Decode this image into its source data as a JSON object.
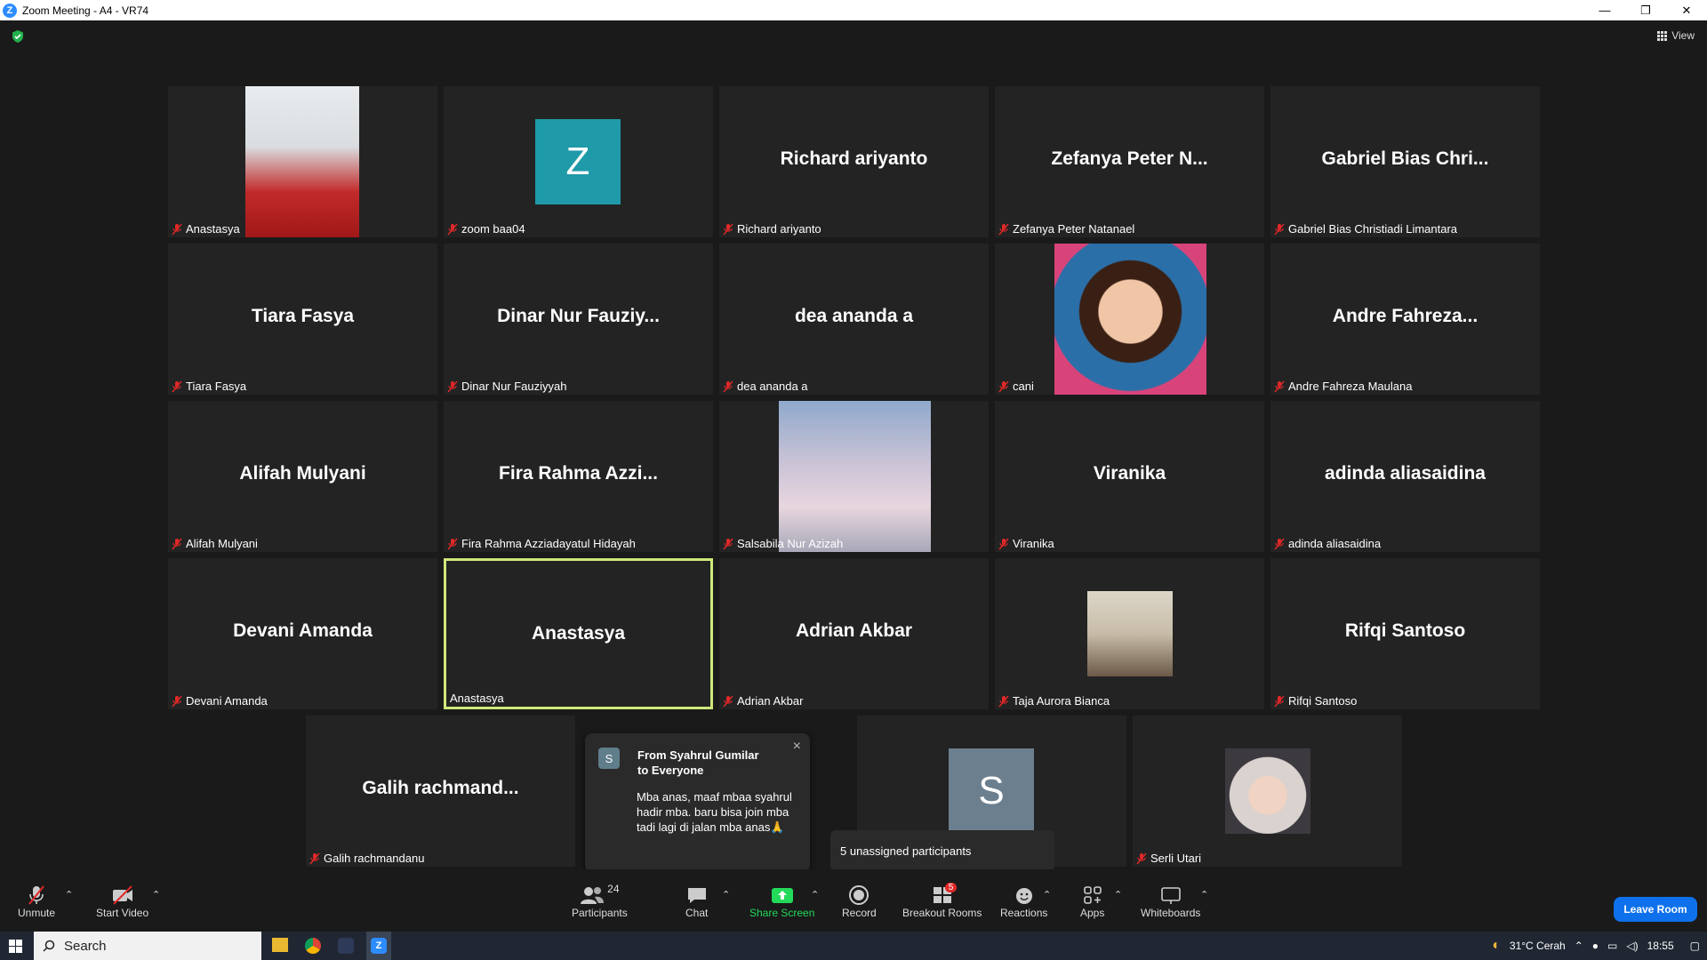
{
  "window": {
    "title": "Zoom Meeting - A4 - VR74",
    "minimize": "—",
    "restore": "❐",
    "close": "✕"
  },
  "view_label": "View",
  "tiles": [
    {
      "big": "",
      "label": "Anastasya",
      "photo": "woman",
      "mic": true
    },
    {
      "big": "",
      "label": "zoom baa04",
      "avatar": "Z",
      "avatar_color": "#1f9aa8",
      "mic": true
    },
    {
      "big": "Richard ariyanto",
      "label": "Richard ariyanto",
      "mic": true
    },
    {
      "big": "Zefanya Peter N...",
      "label": "Zefanya Peter Natanael",
      "mic": true
    },
    {
      "big": "Gabriel Bias Chri...",
      "label": "Gabriel Bias Christiadi Limantara",
      "mic": true
    },
    {
      "big": "Tiara Fasya",
      "label": "Tiara Fasya",
      "mic": true
    },
    {
      "big": "Dinar Nur Fauziy...",
      "label": "Dinar Nur Fauziyyah",
      "mic": true
    },
    {
      "big": "dea ananda a",
      "label": "dea ananda a",
      "mic": true
    },
    {
      "big": "",
      "label": "cani",
      "photo": "child",
      "mic": true
    },
    {
      "big": "Andre Fahreza...",
      "label": "Andre Fahreza Maulana",
      "mic": true
    },
    {
      "big": "Alifah Mulyani",
      "label": "Alifah Mulyani",
      "mic": true
    },
    {
      "big": "Fira Rahma Azzi...",
      "label": "Fira Rahma Azziadayatul Hidayah",
      "mic": true
    },
    {
      "big": "",
      "label": "Salsabila Nur Azizah",
      "photo": "sky",
      "mic": true
    },
    {
      "big": "Viranika",
      "label": "Viranika",
      "mic": true
    },
    {
      "big": "adinda aliasaidina",
      "label": "adinda aliasaidina",
      "mic": true
    },
    {
      "big": "Devani Amanda",
      "label": "Devani Amanda",
      "mic": true
    },
    {
      "big": "Anastasya",
      "label": "Anastasya",
      "mic": false,
      "active": true
    },
    {
      "big": "Adrian Akbar",
      "label": "Adrian Akbar",
      "mic": true
    },
    {
      "big": "",
      "label": "Taja Aurora Bianca",
      "photo": "room",
      "mic": true
    },
    {
      "big": "Rifqi Santoso",
      "label": "Rifqi Santoso",
      "mic": true
    },
    {
      "big": "Galih rachmand...",
      "label": "Galih rachmandanu",
      "mic": true
    },
    {
      "big": "",
      "label": "",
      "mic": false
    },
    {
      "big": "",
      "label": "",
      "avatar": "S",
      "avatar_color": "#6b7f8f",
      "mic": false
    },
    {
      "big": "",
      "label": "Serli Utari",
      "photo": "hijab",
      "mic": true
    }
  ],
  "chat": {
    "avatar": "S",
    "from": "From Syahrul Gumilar to Everyone",
    "message": "Mba anas, maaf mbaa syahrul hadir mba. baru bisa join mba tadi lagi di jalan mba anas🙏",
    "close": "×"
  },
  "unassigned": "5 unassigned participants",
  "toolbar": {
    "unmute": "Unmute",
    "start_video": "Start Video",
    "participants": "Participants",
    "participants_count": "24",
    "chat": "Chat",
    "share": "Share Screen",
    "record": "Record",
    "breakout": "Breakout Rooms",
    "breakout_badge": "5",
    "reactions": "Reactions",
    "apps": "Apps",
    "whiteboards": "Whiteboards",
    "leave": "Leave Room",
    "share_color": "#23d959"
  },
  "taskbar": {
    "search": "Search",
    "weather": "31°C  Cerah",
    "time": "18:55"
  }
}
